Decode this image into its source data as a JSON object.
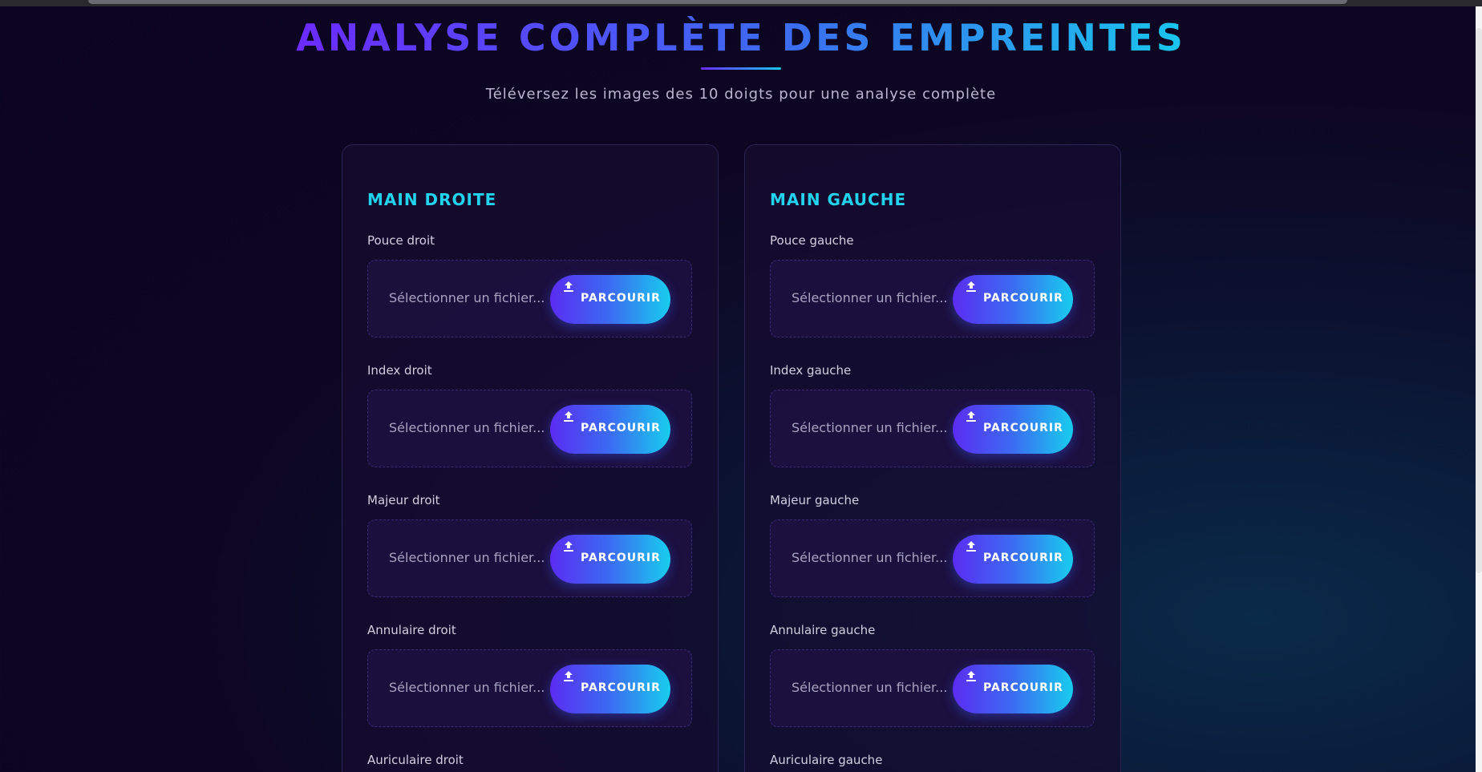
{
  "header": {
    "title": "ANALYSE COMPLÈTE DES EMPREINTES",
    "subtitle": "Téléversez les images des 10 doigts pour une analyse complète"
  },
  "hands": [
    {
      "title": "MAIN DROITE",
      "fingers": [
        {
          "label": "Pouce droit",
          "placeholder": "Sélectionner un fichier...",
          "button": "PARCOURIR"
        },
        {
          "label": "Index droit",
          "placeholder": "Sélectionner un fichier...",
          "button": "PARCOURIR"
        },
        {
          "label": "Majeur droit",
          "placeholder": "Sélectionner un fichier...",
          "button": "PARCOURIR"
        },
        {
          "label": "Annulaire droit",
          "placeholder": "Sélectionner un fichier...",
          "button": "PARCOURIR"
        },
        {
          "label": "Auriculaire droit"
        }
      ]
    },
    {
      "title": "MAIN GAUCHE",
      "fingers": [
        {
          "label": "Pouce gauche",
          "placeholder": "Sélectionner un fichier...",
          "button": "PARCOURIR"
        },
        {
          "label": "Index gauche",
          "placeholder": "Sélectionner un fichier...",
          "button": "PARCOURIR"
        },
        {
          "label": "Majeur gauche",
          "placeholder": "Sélectionner un fichier...",
          "button": "PARCOURIR"
        },
        {
          "label": "Annulaire gauche",
          "placeholder": "Sélectionner un fichier...",
          "button": "PARCOURIR"
        },
        {
          "label": "Auriculaire gauche"
        }
      ]
    }
  ],
  "icons": {
    "upload": "upload-icon"
  },
  "colors": {
    "accent_purple": "#6b2bff",
    "accent_cyan": "#19c6ee",
    "heading_cyan": "#22d3ee"
  }
}
